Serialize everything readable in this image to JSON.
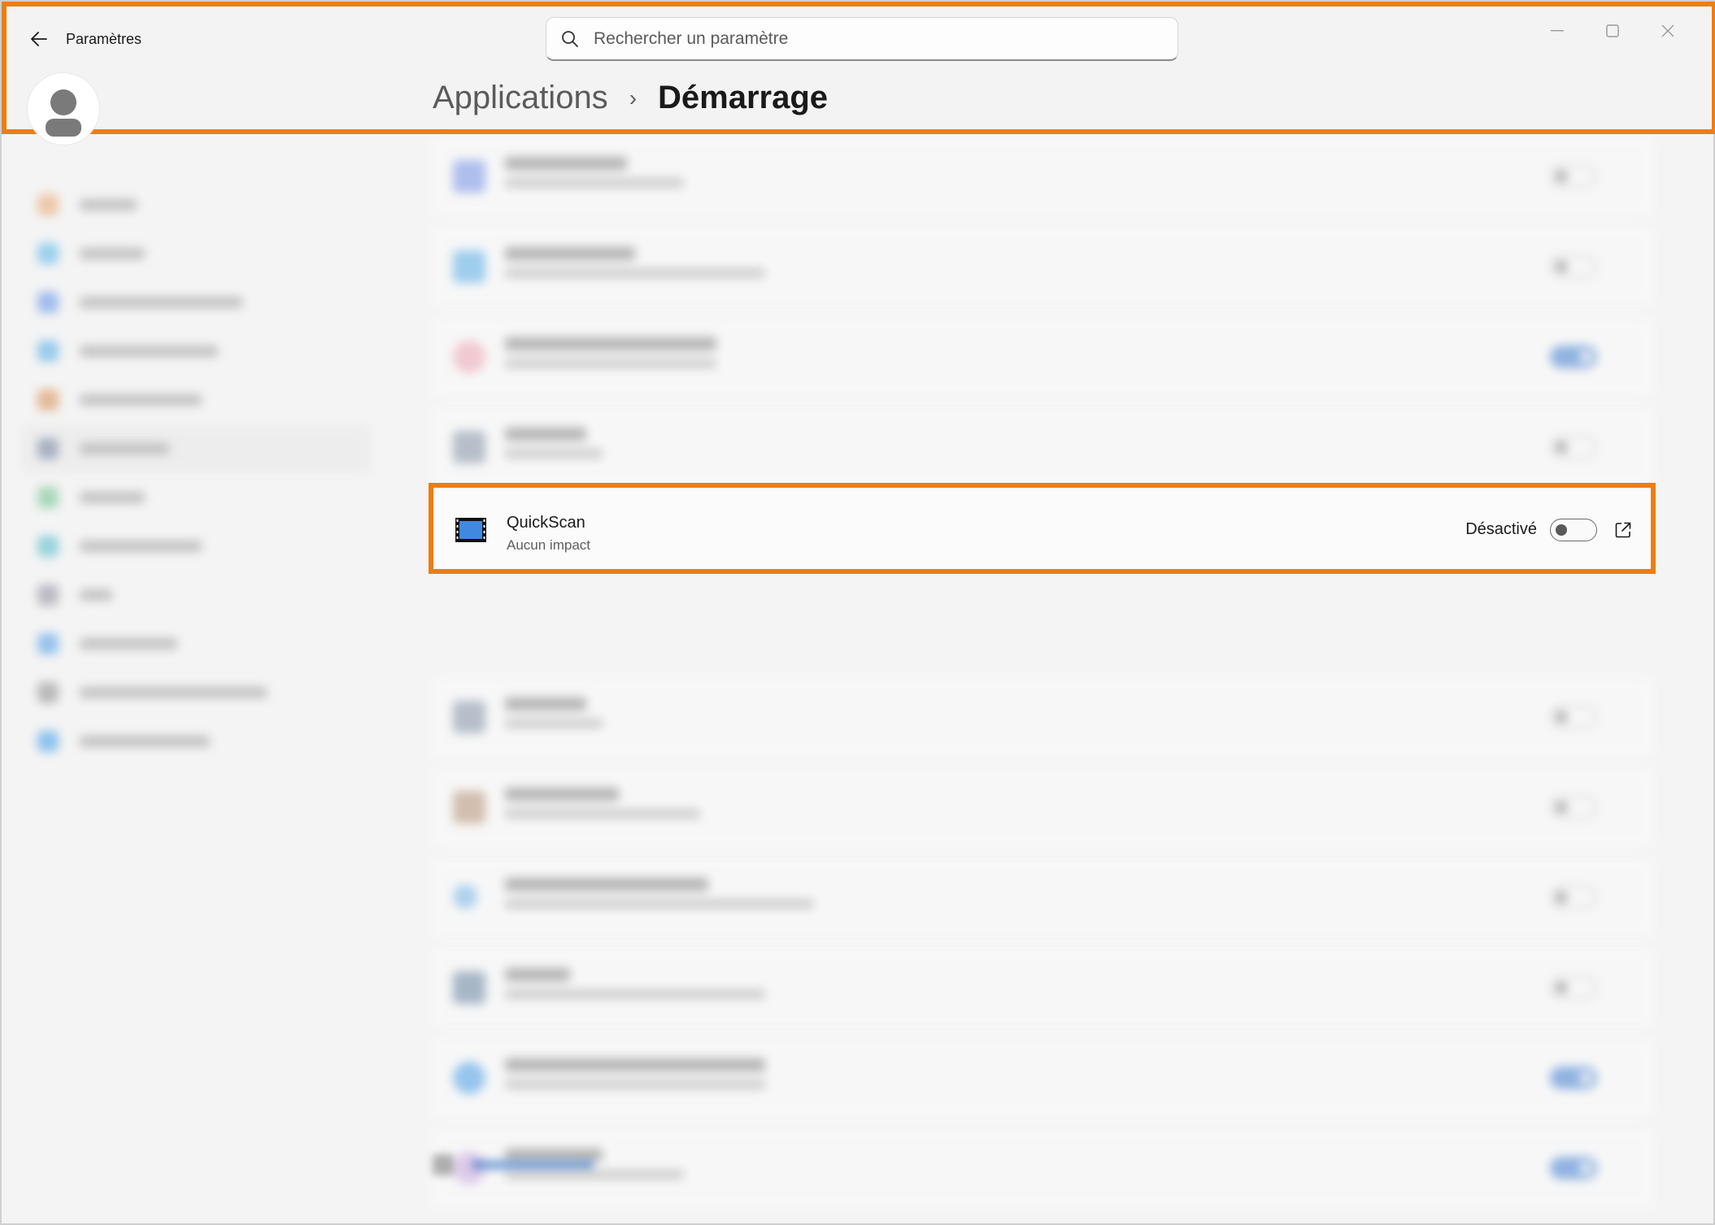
{
  "window": {
    "app_title": "Paramètres",
    "minimize": "—",
    "maximize": "☐",
    "close": "✕"
  },
  "search": {
    "placeholder": "Rechercher un paramètre"
  },
  "breadcrumb": {
    "parent": "Applications",
    "separator": "›",
    "current": "Démarrage"
  },
  "highlighted_app": {
    "name": "QuickScan",
    "impact": "Aucun impact",
    "state": "Désactivé",
    "enabled": false
  },
  "colors": {
    "highlight_border": "#ef7d10",
    "toggle_on": "#2f74d0"
  }
}
